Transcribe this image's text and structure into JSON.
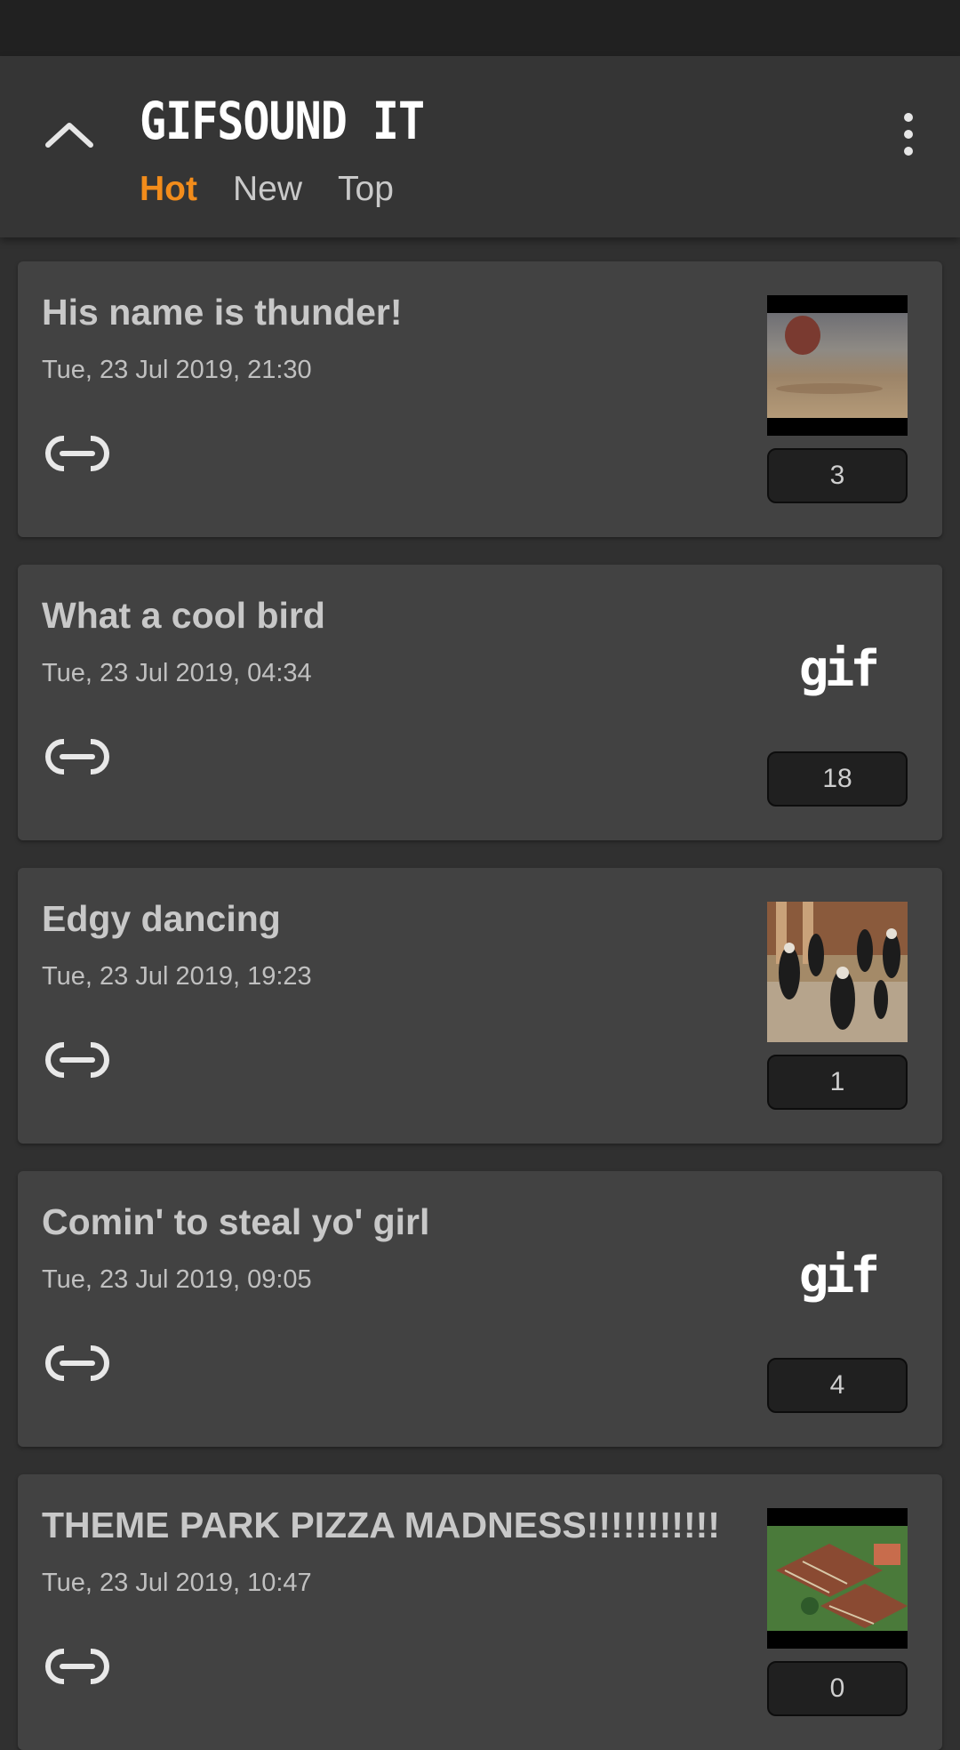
{
  "app": {
    "brand": "GIFSOUND IT"
  },
  "header": {
    "up_icon": "chevron-up-icon",
    "menu_icon": "more-vert-icon",
    "tabs": [
      {
        "label": "Hot",
        "active": true
      },
      {
        "label": "New",
        "active": false
      },
      {
        "label": "Top",
        "active": false
      }
    ]
  },
  "colors": {
    "accent": "#f28c1b",
    "background": "#303030",
    "card": "#424242",
    "appbar": "#353535"
  },
  "posts": [
    {
      "title": "His name is thunder!",
      "date": "Tue, 23 Jul 2019, 21:30",
      "score": "3",
      "thumb": "video-frame-dirt"
    },
    {
      "title": "What a cool bird",
      "date": "Tue, 23 Jul 2019, 04:34",
      "score": "18",
      "thumb": "gif-logo",
      "gif_text": "gif"
    },
    {
      "title": "Edgy dancing",
      "date": "Tue, 23 Jul 2019, 19:23",
      "score": "1",
      "thumb": "video-frame-dancers"
    },
    {
      "title": "Comin' to steal yo' girl",
      "date": "Tue, 23 Jul 2019, 09:05",
      "score": "4",
      "thumb": "gif-logo",
      "gif_text": "gif"
    },
    {
      "title": "THEME PARK PIZZA MADNESS!!!!!!!!!!!",
      "date": "Tue, 23 Jul 2019, 10:47",
      "score": "0",
      "thumb": "video-frame-theme-park"
    }
  ]
}
